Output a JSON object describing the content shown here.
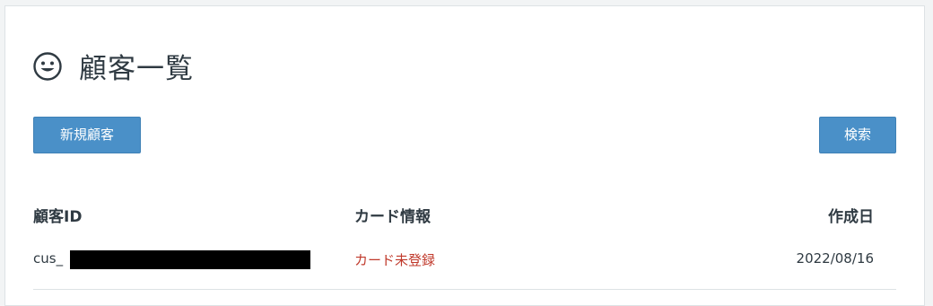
{
  "header": {
    "icon": "smile-icon",
    "title": "顧客一覧"
  },
  "toolbar": {
    "new_label": "新規顧客",
    "search_label": "検索"
  },
  "colors": {
    "button": "#4a90c8",
    "status_red": "#c0392b"
  },
  "table": {
    "columns": [
      "顧客ID",
      "カード情報",
      "作成日"
    ],
    "rows": [
      {
        "id": "cus_",
        "card": "カード未登録",
        "created": "2022/08/16"
      }
    ]
  }
}
